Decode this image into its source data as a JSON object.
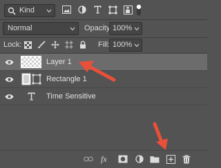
{
  "filter": {
    "kind_label": "Kind"
  },
  "blend": {
    "mode": "Normal",
    "opacity_label": "Opacity:",
    "opacity_value": "100%"
  },
  "lock": {
    "label": "Lock:",
    "fill_label": "Fill:",
    "fill_value": "100%"
  },
  "layers": [
    {
      "name": "Layer 1",
      "selected": true,
      "type": "pixel"
    },
    {
      "name": "Rectangle 1",
      "selected": false,
      "type": "shape"
    },
    {
      "name": "Time Sensitive",
      "selected": false,
      "type": "text"
    }
  ],
  "annotations": {
    "arrow_color": "#e8503a"
  },
  "colors": {
    "panel_bg": "#535353",
    "selected_row": "#6c6c6c",
    "field_bg": "#454545"
  },
  "footer_icons": [
    "link-icon",
    "fx-icon",
    "mask-icon",
    "adjustment-icon",
    "folder-icon",
    "new-layer-icon",
    "trash-icon"
  ]
}
